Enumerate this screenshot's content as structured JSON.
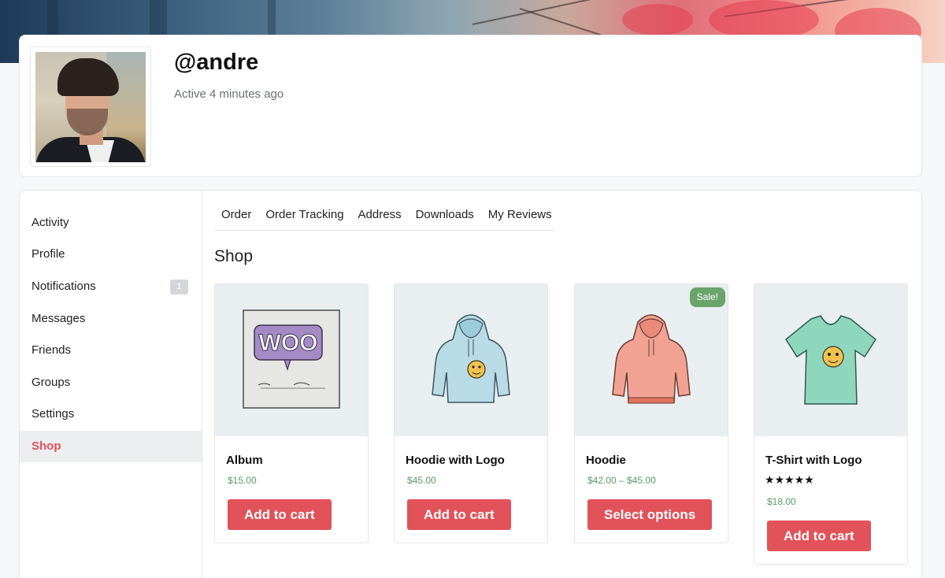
{
  "cover": {
    "description_icon": "cover-photo"
  },
  "profile": {
    "username": "@andre",
    "active_status": "Active 4 minutes ago",
    "avatar_icon": "avatar"
  },
  "sidebar": {
    "items": [
      {
        "label": "Activity"
      },
      {
        "label": "Profile"
      },
      {
        "label": "Notifications",
        "badge": "1"
      },
      {
        "label": "Messages"
      },
      {
        "label": "Friends"
      },
      {
        "label": "Groups"
      },
      {
        "label": "Settings"
      },
      {
        "label": "Shop",
        "active": true
      }
    ]
  },
  "subnav": {
    "items": [
      "Order",
      "Order Tracking",
      "Address",
      "Downloads",
      "My Reviews"
    ]
  },
  "shop": {
    "title": "Shop",
    "products": [
      {
        "name": "Album",
        "price": "$15.00",
        "button": "Add to cart",
        "image_icon": "woo-album-image"
      },
      {
        "name": "Hoodie with Logo",
        "price": "$45.00",
        "button": "Add to cart",
        "image_icon": "blue-hoodie-image"
      },
      {
        "name": "Hoodie",
        "price": "$42.00 – $45.00",
        "button": "Select options",
        "sale": "Sale!",
        "image_icon": "pink-hoodie-image"
      },
      {
        "name": "T-Shirt with Logo",
        "price": "$18.00",
        "button": "Add to cart",
        "rating": 5,
        "image_icon": "tshirt-image"
      }
    ]
  },
  "colors": {
    "accent": "#e2525a",
    "price": "#5b9a68",
    "sale": "#6aa46b"
  }
}
